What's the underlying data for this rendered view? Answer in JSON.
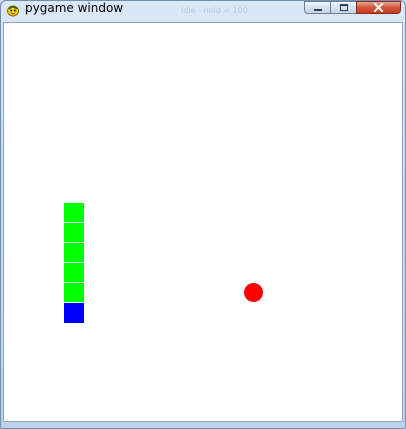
{
  "window": {
    "title": "pygame window",
    "ghost_title": "Idle - hold = 100"
  },
  "icons": {
    "app": "pygame-snake-icon",
    "minimize": "minimize-icon",
    "maximize": "maximize-icon",
    "close": "close-icon"
  },
  "game": {
    "grid_cell": 20,
    "snake": {
      "body_color": "#00ff00",
      "head_color": "#0000ff",
      "segments": [
        {
          "col": 3,
          "row": 9,
          "part": "body"
        },
        {
          "col": 3,
          "row": 10,
          "part": "body"
        },
        {
          "col": 3,
          "row": 11,
          "part": "body"
        },
        {
          "col": 3,
          "row": 12,
          "part": "body"
        },
        {
          "col": 3,
          "row": 13,
          "part": "body"
        },
        {
          "col": 3,
          "row": 14,
          "part": "head"
        }
      ]
    },
    "food": {
      "col": 12,
      "row": 13,
      "color": "#ff0000"
    },
    "background_color": "#ffffff"
  }
}
